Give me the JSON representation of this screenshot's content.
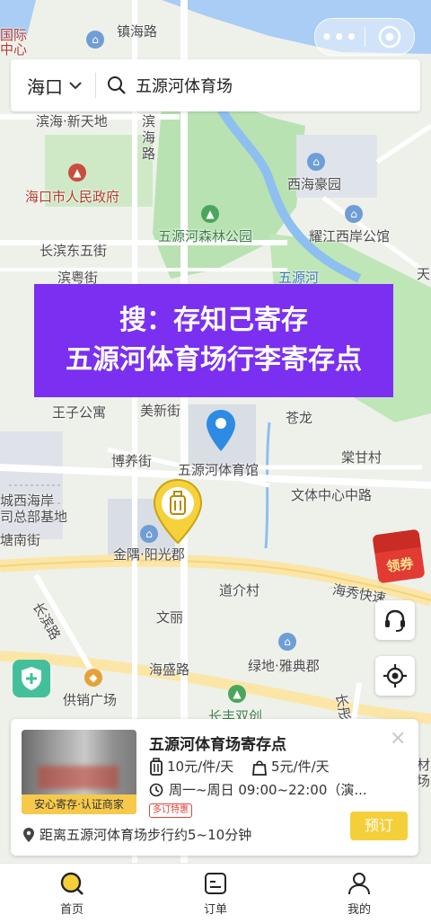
{
  "topbar": {
    "more_icon": "more-dots-icon",
    "target_icon": "record-target-icon"
  },
  "search": {
    "city": "海口",
    "query": "五源河体育场"
  },
  "banner": {
    "line1": "搜：存知己寄存",
    "line2": "五源河体育场行李寄存点"
  },
  "map": {
    "labels": {
      "zhenhai": "镇海路",
      "guoji": "国际",
      "zhongxin": "中心",
      "binhai_xintiandi": "滨海·新天地",
      "binhai_road": "滨",
      "binhai_road2": "海",
      "binhai_road3": "路",
      "haikou_gov": "海口市人民政府",
      "xihai_haoyuan": "西海豪园",
      "forest_park": "五源河森林公园",
      "yaojiang": "耀江西岸公馆",
      "changbin": "长滨东五街",
      "binyue": "滨粤街",
      "wuyuanhe": "五源河",
      "tian": "天",
      "meixin": "美新街",
      "wangzi": "王子公寓",
      "canglong": "苍龙",
      "stadium": "五源河体育馆",
      "tanggan": "棠甘村",
      "boyang": "博养街",
      "wenti": "文体中心中路",
      "chengxi": "城西海岸",
      "zongbu": "司总部基地",
      "tangnan": "塘南街",
      "jinyu": "金隅·阳光郡",
      "daojie": "道介村",
      "haixiu": "海秀快速",
      "wenli": "文丽",
      "changbin_road": "长滨路",
      "haisheng": "海盛路",
      "lvdi": "绿地·雅典郡",
      "gongxiao": "供销广场",
      "changfeng": "长丰双创",
      "cai": "材",
      "chang": "场",
      "chang_east": "长彤"
    }
  },
  "coupon": {
    "label": "领券"
  },
  "card": {
    "name": "五源河体育场寄存点",
    "badge": "安心寄存·认证商家",
    "price_large": "10元/件/天",
    "price_small": "5元/件/天",
    "hours": "周一~周日 09:00~22:00（演...",
    "tag": "多订特惠",
    "distance": "距离五源河体育场步行约5~10分钟",
    "reserve": "预订"
  },
  "tabs": [
    {
      "label": "首页",
      "icon": "home-search-icon",
      "active": true
    },
    {
      "label": "订单",
      "icon": "order-icon",
      "active": false
    },
    {
      "label": "我的",
      "icon": "profile-icon",
      "active": false
    }
  ]
}
